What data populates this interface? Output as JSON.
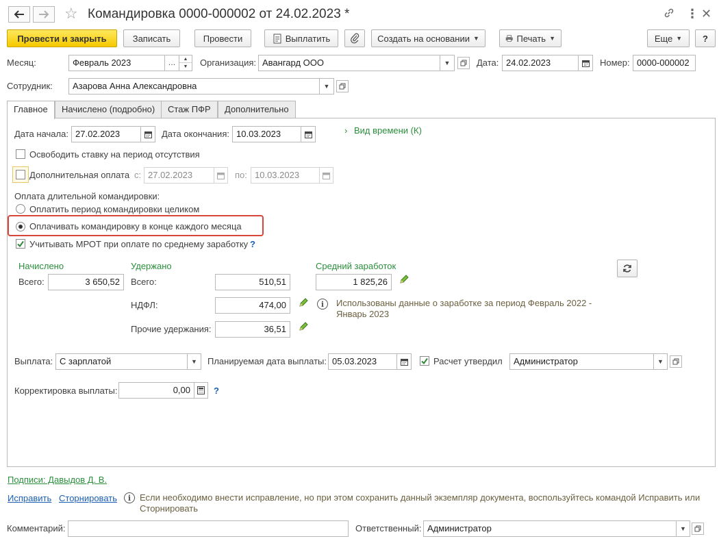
{
  "window": {
    "title": "Командировка 0000-000002 от 24.02.2023 *"
  },
  "toolbar": {
    "post_close": "Провести и закрыть",
    "save": "Записать",
    "post": "Провести",
    "pay": "Выплатить",
    "create_based": "Создать на основании",
    "print": "Печать",
    "more": "Еще",
    "help": "?"
  },
  "header": {
    "month_label": "Месяц:",
    "month_value": "Февраль 2023",
    "org_label": "Организация:",
    "org_value": "Авангард ООО",
    "date_label": "Дата:",
    "date_value": "24.02.2023",
    "number_label": "Номер:",
    "number_value": "0000-000002",
    "employee_label": "Сотрудник:",
    "employee_value": "Азарова Анна Александровна"
  },
  "tabs": [
    {
      "label": "Главное"
    },
    {
      "label": "Начислено (подробно)"
    },
    {
      "label": "Стаж ПФР"
    },
    {
      "label": "Дополнительно"
    }
  ],
  "main": {
    "start_label": "Дата начала:",
    "start_value": "27.02.2023",
    "end_label": "Дата окончания:",
    "end_value": "10.03.2023",
    "time_kind_link": "Вид времени (К)",
    "release_rate": "Освободить ставку на период отсутствия",
    "extra_pay": "Дополнительная оплата",
    "extra_from_label": "с:",
    "extra_from_value": "27.02.2023",
    "extra_to_label": "по:",
    "extra_to_value": "10.03.2023",
    "long_trip_label": "Оплата длительной командировки:",
    "radio_whole": "Оплатить период командировки целиком",
    "radio_monthly": "Оплачивать командировку в конце каждого месяца",
    "mrot": "Учитывать МРОТ при оплате по среднему заработку",
    "mrot_help": "?"
  },
  "totals": {
    "accrued_header": "Начислено",
    "accrued_total_label": "Всего:",
    "accrued_total_value": "3 650,52",
    "withheld_header": "Удержано",
    "withheld_total_label": "Всего:",
    "withheld_total_value": "510,51",
    "ndfl_label": "НДФЛ:",
    "ndfl_value": "474,00",
    "other_label": "Прочие удержания:",
    "other_value": "36,51",
    "avg_header": "Средний заработок",
    "avg_value": "1 825,26",
    "avg_info": "Использованы данные о заработке за период Февраль 2022 - Январь 2023"
  },
  "payment": {
    "payout_label": "Выплата:",
    "payout_value": "С зарплатой",
    "planned_label": "Планируемая дата выплаты:",
    "planned_value": "05.03.2023",
    "approved_label": "Расчет утвердил",
    "approved_value": "Администратор",
    "correction_label": "Корректировка выплаты:",
    "correction_value": "0,00",
    "correction_help": "?"
  },
  "footer": {
    "signatures": "Подписи: Давыдов Д. В.",
    "fix": "Исправить",
    "reverse": "Сторнировать",
    "fix_info": "Если необходимо внести исправление, но при этом сохранить данный экземпляр документа, воспользуйтесь командой Исправить или Сторнировать",
    "comment_label": "Комментарий:",
    "comment_value": "",
    "responsible_label": "Ответственный:",
    "responsible_value": "Администратор"
  }
}
